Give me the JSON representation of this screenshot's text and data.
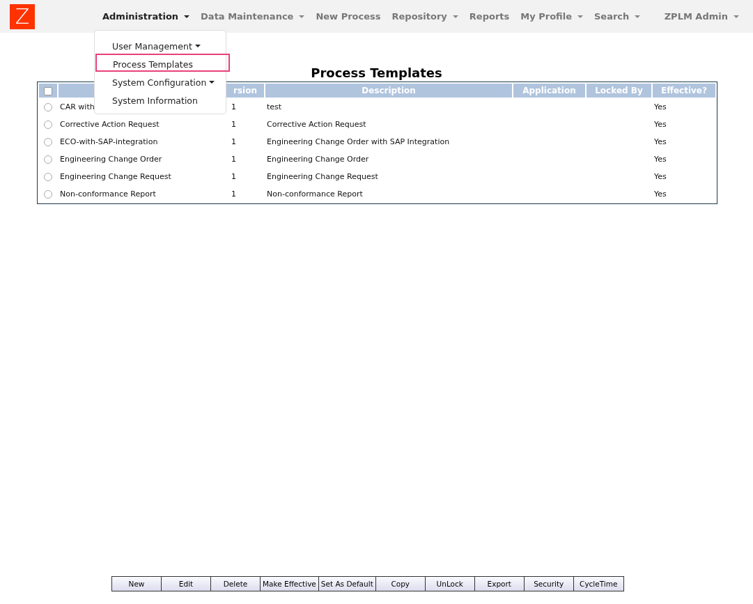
{
  "logo": {
    "letter": "Z"
  },
  "nav": [
    {
      "label": "Administration",
      "caret": true,
      "selected": true
    },
    {
      "label": "Data Maintenance",
      "caret": true,
      "selected": false
    },
    {
      "label": "New Process",
      "caret": false,
      "selected": false
    },
    {
      "label": "Repository",
      "caret": true,
      "selected": false
    },
    {
      "label": "Reports",
      "caret": false,
      "selected": false
    },
    {
      "label": "My Profile",
      "caret": true,
      "selected": false
    },
    {
      "label": "Search",
      "caret": true,
      "selected": false
    }
  ],
  "user_menu": {
    "label": "ZPLM Admin",
    "caret": true
  },
  "dropdown": [
    {
      "label": "User Management",
      "submenu": true,
      "selected": false
    },
    {
      "label": "Process Templates",
      "submenu": false,
      "selected": true
    },
    {
      "label": "System Configuration",
      "submenu": true,
      "selected": false
    },
    {
      "label": "System Information",
      "submenu": false,
      "selected": false
    }
  ],
  "page_title": "Process Templates",
  "table": {
    "select_all_checked": false,
    "columns": [
      "rsion",
      "Description",
      "Application",
      "Locked By",
      "Effective?"
    ],
    "rows": [
      {
        "selected": false,
        "name": "CAR with",
        "version": "1",
        "description": "test",
        "effective": "Yes"
      },
      {
        "selected": false,
        "name": "Corrective Action Request",
        "version": "1",
        "description": "Corrective Action Request",
        "effective": "Yes"
      },
      {
        "selected": false,
        "name": "ECO-with-SAP-integration",
        "version": "1",
        "description": "Engineering Change Order with SAP Integration",
        "effective": "Yes"
      },
      {
        "selected": false,
        "name": "Engineering Change Order",
        "version": "1",
        "description": "Engineering Change Order",
        "effective": "Yes"
      },
      {
        "selected": false,
        "name": "Engineering Change Request",
        "version": "1",
        "description": "Engineering Change Request",
        "effective": "Yes"
      },
      {
        "selected": false,
        "name": "Non-conformance Report",
        "version": "1",
        "description": "Non-conformance Report",
        "effective": "Yes"
      }
    ]
  },
  "buttons": [
    "New",
    "Edit",
    "Delete",
    "Make Effective",
    "Set As Default",
    "Copy",
    "UnLock",
    "Export",
    "Security",
    "CycleTime"
  ]
}
